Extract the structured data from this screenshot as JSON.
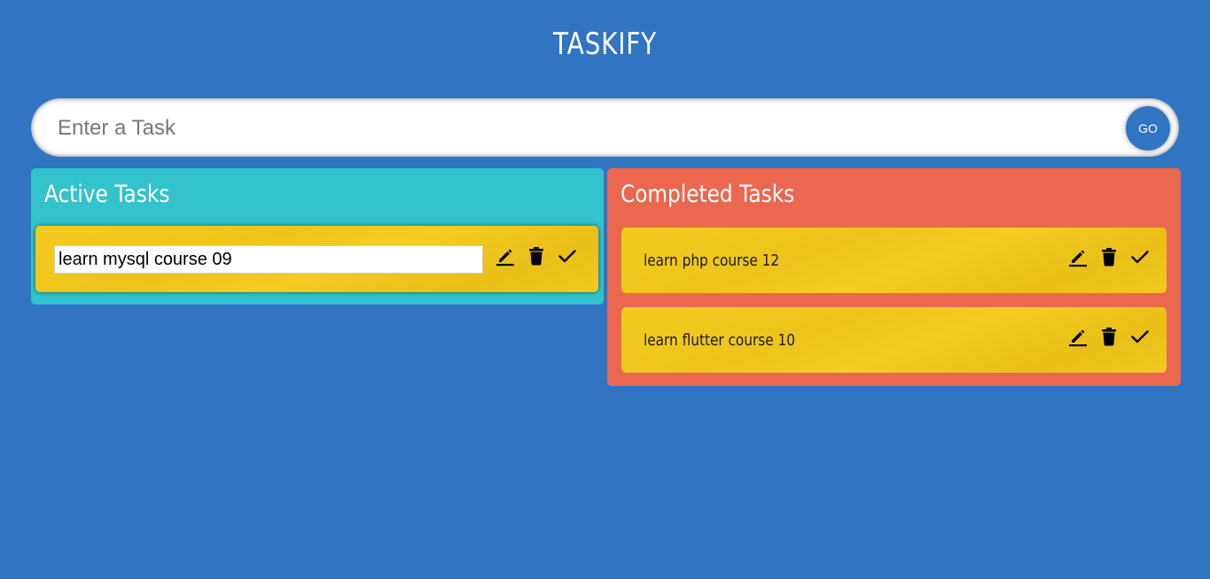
{
  "app": {
    "title": "TASKIFY"
  },
  "task_input": {
    "placeholder": "Enter a Task",
    "value": "",
    "submit_label": "GO"
  },
  "active": {
    "heading": "Active Tasks",
    "tasks": [
      {
        "text": "learn mysql course 09",
        "editing": true
      }
    ]
  },
  "completed": {
    "heading": "Completed Tasks",
    "tasks": [
      {
        "text": "learn php course 12"
      },
      {
        "text": "learn flutter course 10"
      }
    ]
  },
  "icons": [
    "edit-icon",
    "delete-icon",
    "check-icon"
  ],
  "colors": {
    "background": "#3074c2",
    "active_panel": "#32c3cd",
    "completed_panel": "#eb6750",
    "card": "#f0c81e",
    "button": "#3074c2"
  }
}
